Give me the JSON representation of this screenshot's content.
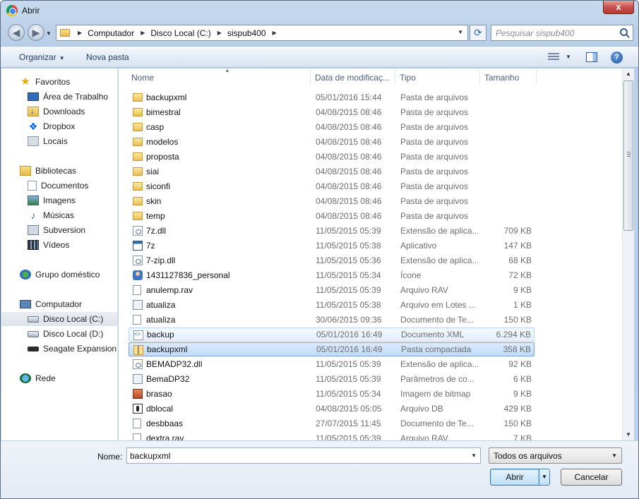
{
  "window": {
    "title": "Abrir",
    "close_label": "x"
  },
  "address": {
    "crumbs": [
      "Computador",
      "Disco Local (C:)",
      "sispub400"
    ],
    "search_placeholder": "Pesquisar sispub400"
  },
  "toolbar": {
    "organize_label": "Organizar",
    "new_folder_label": "Nova pasta",
    "help_label": "?"
  },
  "sidebar": {
    "items": [
      {
        "label": "Favoritos",
        "icon": "star-icon"
      },
      {
        "label": "Área de Trabalho",
        "icon": "desktop-icon"
      },
      {
        "label": "Downloads",
        "icon": "downloads-icon"
      },
      {
        "label": "Dropbox",
        "icon": "dropbox-icon"
      },
      {
        "label": "Locais",
        "icon": "places-icon"
      },
      {
        "label": "Bibliotecas",
        "icon": "libraries-icon"
      },
      {
        "label": "Documentos",
        "icon": "documents-icon"
      },
      {
        "label": "Imagens",
        "icon": "images-icon"
      },
      {
        "label": "Músicas",
        "icon": "music-icon"
      },
      {
        "label": "Subversion",
        "icon": "subversion-icon"
      },
      {
        "label": "Vídeos",
        "icon": "videos-icon"
      },
      {
        "label": "Grupo doméstico",
        "icon": "homegroup-icon"
      },
      {
        "label": "Computador",
        "icon": "computer-icon"
      },
      {
        "label": "Disco Local (C:)",
        "icon": "drive-icon"
      },
      {
        "label": "Disco Local (D:)",
        "icon": "drive-icon"
      },
      {
        "label": "Seagate Expansion D",
        "icon": "external-drive-icon"
      },
      {
        "label": "Rede",
        "icon": "network-icon"
      }
    ]
  },
  "columns": {
    "name": "Nome",
    "date": "Data de modificaç...",
    "type": "Tipo",
    "size": "Tamanho"
  },
  "files": [
    {
      "name": "backupxml",
      "date": "05/01/2016 15:44",
      "type": "Pasta de arquivos",
      "size": "",
      "icon": "folder"
    },
    {
      "name": "bimestral",
      "date": "04/08/2015 08:46",
      "type": "Pasta de arquivos",
      "size": "",
      "icon": "folder"
    },
    {
      "name": "casp",
      "date": "04/08/2015 08:46",
      "type": "Pasta de arquivos",
      "size": "",
      "icon": "folder"
    },
    {
      "name": "modelos",
      "date": "04/08/2015 08:46",
      "type": "Pasta de arquivos",
      "size": "",
      "icon": "folder"
    },
    {
      "name": "proposta",
      "date": "04/08/2015 08:46",
      "type": "Pasta de arquivos",
      "size": "",
      "icon": "folder"
    },
    {
      "name": "siai",
      "date": "04/08/2015 08:46",
      "type": "Pasta de arquivos",
      "size": "",
      "icon": "folder"
    },
    {
      "name": "siconfi",
      "date": "04/08/2015 08:46",
      "type": "Pasta de arquivos",
      "size": "",
      "icon": "folder"
    },
    {
      "name": "skin",
      "date": "04/08/2015 08:46",
      "type": "Pasta de arquivos",
      "size": "",
      "icon": "folder"
    },
    {
      "name": "temp",
      "date": "04/08/2015 08:46",
      "type": "Pasta de arquivos",
      "size": "",
      "icon": "folder"
    },
    {
      "name": "7z.dll",
      "date": "11/05/2015 05:39",
      "type": "Extensão de aplica...",
      "size": "709 KB",
      "icon": "dll"
    },
    {
      "name": "7z",
      "date": "11/05/2015 05:38",
      "type": "Aplicativo",
      "size": "147 KB",
      "icon": "exe"
    },
    {
      "name": "7-zip.dll",
      "date": "11/05/2015 05:36",
      "type": "Extensão de aplica...",
      "size": "68 KB",
      "icon": "dll"
    },
    {
      "name": "1431127836_personal",
      "date": "11/05/2015 05:34",
      "type": "Ícone",
      "size": "72 KB",
      "icon": "ico"
    },
    {
      "name": "anulemp.rav",
      "date": "11/05/2015 05:39",
      "type": "Arquivo RAV",
      "size": "9 KB",
      "icon": "doc"
    },
    {
      "name": "atualiza",
      "date": "11/05/2015 05:38",
      "type": "Arquivo em Lotes ...",
      "size": "1 KB",
      "icon": "bat"
    },
    {
      "name": "atualiza",
      "date": "30/06/2015 09:36",
      "type": "Documento de Te...",
      "size": "150 KB",
      "icon": "doc"
    },
    {
      "name": "backup",
      "date": "05/01/2016 16:49",
      "type": "Documento XML",
      "size": "6.294 KB",
      "icon": "xml"
    },
    {
      "name": "backupxml",
      "date": "05/01/2016 16:49",
      "type": "Pasta compactada",
      "size": "358 KB",
      "icon": "zip"
    },
    {
      "name": "BEMADP32.dll",
      "date": "11/05/2015 05:39",
      "type": "Extensão de aplica...",
      "size": "92 KB",
      "icon": "dll"
    },
    {
      "name": "BemaDP32",
      "date": "11/05/2015 05:39",
      "type": "Parâmetros de co...",
      "size": "6 KB",
      "icon": "bat"
    },
    {
      "name": "brasao",
      "date": "11/05/2015 05:34",
      "type": "Imagem de bitmap",
      "size": "9 KB",
      "icon": "bmp"
    },
    {
      "name": "dblocal",
      "date": "04/08/2015 05:05",
      "type": "Arquivo DB",
      "size": "429 KB",
      "icon": "db"
    },
    {
      "name": "desbbaas",
      "date": "27/07/2015 11:45",
      "type": "Documento de Te...",
      "size": "150 KB",
      "icon": "doc"
    },
    {
      "name": "dextra.rav",
      "date": "11/05/2015 05:39",
      "type": "Arquivo RAV",
      "size": "7 KB",
      "icon": "doc"
    }
  ],
  "footer": {
    "name_label": "Nome:",
    "name_value": "backupxml",
    "filter_value": "Todos os arquivos",
    "open_label": "Abrir",
    "cancel_label": "Cancelar"
  }
}
